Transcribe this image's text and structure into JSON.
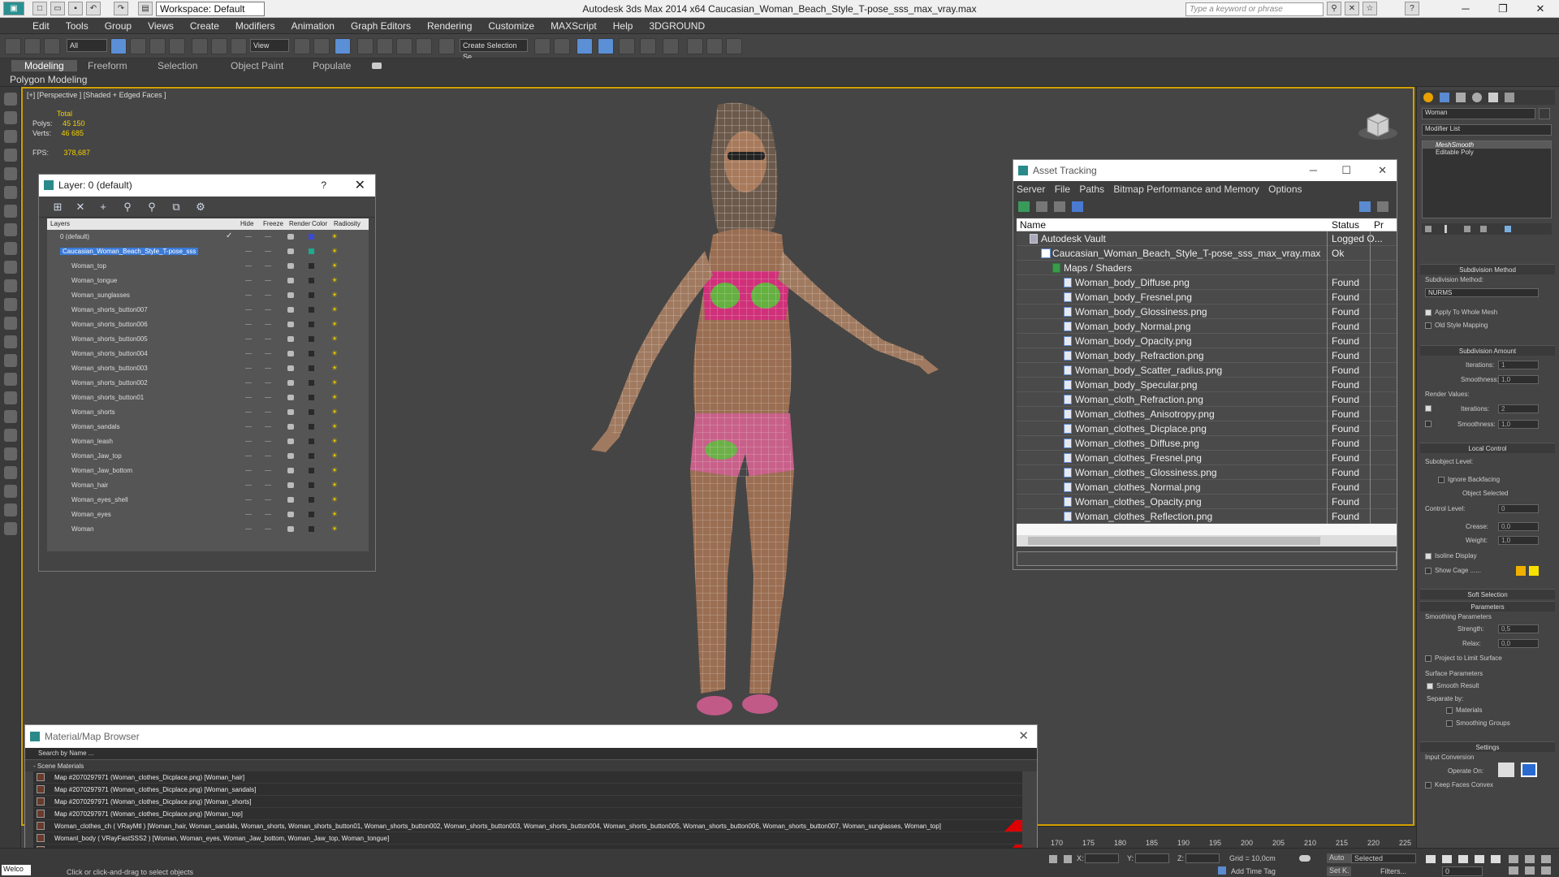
{
  "window": {
    "title": "Autodesk 3ds Max  2014 x64    Caucasian_Woman_Beach_Style_T-pose_sss_max_vray.max",
    "workspace": "Workspace: Default",
    "search_placeholder": "Type a keyword or phrase"
  },
  "menu": [
    "Edit",
    "Tools",
    "Group",
    "Views",
    "Create",
    "Modifiers",
    "Animation",
    "Graph Editors",
    "Rendering",
    "Customize",
    "MAXScript",
    "Help",
    "3DGROUND"
  ],
  "toolbar": {
    "filter": "All",
    "refcoord": "View",
    "selection_set": "Create Selection Se"
  },
  "ribbon": {
    "tabs": [
      "Modeling",
      "Freeform",
      "Selection",
      "Object Paint",
      "Populate"
    ],
    "sub": "Polygon Modeling"
  },
  "viewport": {
    "label": "[+] [Perspective ] [Shaded + Edged Faces ]",
    "stats_total": "Total",
    "polys_label": "Polys:",
    "polys": "45 150",
    "verts_label": "Verts:",
    "verts": "46 685",
    "fps_label": "FPS:",
    "fps": "378,687"
  },
  "layer_dialog": {
    "title": "Layer: 0 (default)",
    "help": "?",
    "columns": [
      "Layers",
      "Hide",
      "Freeze",
      "Render",
      "Color",
      "Radiosity"
    ],
    "rows": [
      {
        "name": "0 (default)",
        "level": 0,
        "color": "#3a4ad8",
        "check": true
      },
      {
        "name": "Caucasian_Woman_Beach_Style_T-pose_sss",
        "level": 0,
        "color": "#20a890",
        "selected": true
      },
      {
        "name": "Woman_top",
        "level": 1,
        "color": "#2a2a2a"
      },
      {
        "name": "Woman_tongue",
        "level": 1,
        "color": "#2a2a2a"
      },
      {
        "name": "Woman_sunglasses",
        "level": 1,
        "color": "#2a2a2a"
      },
      {
        "name": "Woman_shorts_button007",
        "level": 1,
        "color": "#2a2a2a"
      },
      {
        "name": "Woman_shorts_button006",
        "level": 1,
        "color": "#2a2a2a"
      },
      {
        "name": "Woman_shorts_button005",
        "level": 1,
        "color": "#2a2a2a"
      },
      {
        "name": "Woman_shorts_button004",
        "level": 1,
        "color": "#2a2a2a"
      },
      {
        "name": "Woman_shorts_button003",
        "level": 1,
        "color": "#2a2a2a"
      },
      {
        "name": "Woman_shorts_button002",
        "level": 1,
        "color": "#2a2a2a"
      },
      {
        "name": "Woman_shorts_button01",
        "level": 1,
        "color": "#2a2a2a"
      },
      {
        "name": "Woman_shorts",
        "level": 1,
        "color": "#2a2a2a"
      },
      {
        "name": "Woman_sandals",
        "level": 1,
        "color": "#2a2a2a"
      },
      {
        "name": "Woman_leash",
        "level": 1,
        "color": "#2a2a2a"
      },
      {
        "name": "Woman_Jaw_top",
        "level": 1,
        "color": "#2a2a2a"
      },
      {
        "name": "Woman_Jaw_bottom",
        "level": 1,
        "color": "#2a2a2a"
      },
      {
        "name": "Woman_hair",
        "level": 1,
        "color": "#2a2a2a"
      },
      {
        "name": "Woman_eyes_shell",
        "level": 1,
        "color": "#2a2a2a"
      },
      {
        "name": "Woman_eyes",
        "level": 1,
        "color": "#2a2a2a"
      },
      {
        "name": "Woman",
        "level": 1,
        "color": "#2a2a2a"
      }
    ]
  },
  "asset_dialog": {
    "title": "Asset Tracking",
    "menu": [
      "Server",
      "File",
      "Paths",
      "Bitmap Performance and Memory",
      "Options"
    ],
    "columns": {
      "name": "Name",
      "status": "Status",
      "proxy": "Pr"
    },
    "rows": [
      {
        "name": "Autodesk Vault",
        "status": "Logged O...",
        "indent": 0,
        "kind": "vault"
      },
      {
        "name": "Caucasian_Woman_Beach_Style_T-pose_sss_max_vray.max",
        "status": "Ok",
        "indent": 1,
        "kind": "file"
      },
      {
        "name": "Maps / Shaders",
        "status": "",
        "indent": 2,
        "kind": "folder"
      },
      {
        "name": "Woman_body_Diffuse.png",
        "status": "Found",
        "indent": 3,
        "kind": "map"
      },
      {
        "name": "Woman_body_Fresnel.png",
        "status": "Found",
        "indent": 3,
        "kind": "map"
      },
      {
        "name": "Woman_body_Glossiness.png",
        "status": "Found",
        "indent": 3,
        "kind": "map"
      },
      {
        "name": "Woman_body_Normal.png",
        "status": "Found",
        "indent": 3,
        "kind": "map"
      },
      {
        "name": "Woman_body_Opacity.png",
        "status": "Found",
        "indent": 3,
        "kind": "map"
      },
      {
        "name": "Woman_body_Refraction.png",
        "status": "Found",
        "indent": 3,
        "kind": "map"
      },
      {
        "name": "Woman_body_Scatter_radius.png",
        "status": "Found",
        "indent": 3,
        "kind": "map"
      },
      {
        "name": "Woman_body_Specular.png",
        "status": "Found",
        "indent": 3,
        "kind": "map"
      },
      {
        "name": "Woman_cloth_Refraction.png",
        "status": "Found",
        "indent": 3,
        "kind": "map"
      },
      {
        "name": "Woman_clothes_Anisotropy.png",
        "status": "Found",
        "indent": 3,
        "kind": "map"
      },
      {
        "name": "Woman_clothes_Dicplace.png",
        "status": "Found",
        "indent": 3,
        "kind": "map"
      },
      {
        "name": "Woman_clothes_Diffuse.png",
        "status": "Found",
        "indent": 3,
        "kind": "map"
      },
      {
        "name": "Woman_clothes_Fresnel.png",
        "status": "Found",
        "indent": 3,
        "kind": "map"
      },
      {
        "name": "Woman_clothes_Glossiness.png",
        "status": "Found",
        "indent": 3,
        "kind": "map"
      },
      {
        "name": "Woman_clothes_Normal.png",
        "status": "Found",
        "indent": 3,
        "kind": "map"
      },
      {
        "name": "Woman_clothes_Opacity.png",
        "status": "Found",
        "indent": 3,
        "kind": "map"
      },
      {
        "name": "Woman_clothes_Reflection.png",
        "status": "Found",
        "indent": 3,
        "kind": "map"
      }
    ]
  },
  "material_browser": {
    "title": "Material/Map Browser",
    "search": "Search by Name ...",
    "section": "- Scene Materials",
    "rows": [
      {
        "text": "Map #2070297971 (Woman_clothes_Dicplace.png) [Woman_hair]",
        "red": false
      },
      {
        "text": "Map #2070297971 (Woman_clothes_Dicplace.png) [Woman_sandals]",
        "red": false
      },
      {
        "text": "Map #2070297971 (Woman_clothes_Dicplace.png) [Woman_shorts]",
        "red": false
      },
      {
        "text": "Map #2070297971 (Woman_clothes_Dicplace.png) [Woman_top]",
        "red": false
      },
      {
        "text": "Woman_clothes_ch ( VRayMtl ) [Woman_hair, Woman_sandals, Woman_shorts, Woman_shorts_button01, Woman_shorts_button002, Woman_shorts_button003, Woman_shorts_button004, Woman_shorts_button005, Woman_shorts_button006, Woman_shorts_button007, Woman_sunglasses, Woman_top]",
        "red": true
      },
      {
        "text": "Womanl_body ( VRayFastSSS2 ) [Woman, Woman_eyes, Woman_Jaw_bottom, Woman_Jaw_top, Woman_tongue]",
        "red": false
      },
      {
        "text": "Woman_body_detail ( VRayMtl ) [Woman_eyes_shell, Woman_leash]",
        "red": true
      }
    ]
  },
  "command_panel": {
    "object_name": "Woman",
    "modifier_list": "Modifier List",
    "stack": [
      "MeshSmooth",
      "Editable Poly"
    ],
    "subdivision_method_title": "Subdivision Method",
    "subdivision_method_label": "Subdivision Method:",
    "subdivision_method": "NURMS",
    "apply_whole_mesh": "Apply To Whole Mesh",
    "old_style_mapping": "Old Style Mapping",
    "subdivision_amount": "Subdivision Amount",
    "iterations_label": "Iterations:",
    "iterations": "1",
    "smoothness_label": "Smoothness:",
    "smoothness": "1,0",
    "render_values": "Render Values:",
    "r_iterations": "2",
    "r_smoothness": "1,0",
    "local_control": "Local Control",
    "subobject_level": "Subobject Level:",
    "ignore_backfacing": "Ignore Backfacing",
    "object_selected": "Object Selected",
    "control_level": "Control Level:",
    "control_level_val": "0",
    "crease": "Crease:",
    "crease_val": "0,0",
    "weight": "Weight:",
    "weight_val": "1,0",
    "isoline_display": "Isoline Display",
    "show_cage": "Show Cage ......",
    "soft_selection": "Soft Selection",
    "parameters": "Parameters",
    "smoothing_params": "Smoothing Parameters",
    "strength": "Strength:",
    "strength_val": "0,5",
    "relax": "Relax:",
    "relax_val": "0,0",
    "project_limit": "Project to Limit Surface",
    "surface_params": "Surface Parameters",
    "smooth_result": "Smooth Result",
    "separate_by": "Separate by:",
    "materials": "Materials",
    "smoothing_groups": "Smoothing Groups",
    "settings": "Settings",
    "input_conversion": "Input Conversion",
    "operate_on": "Operate On:",
    "keep_faces_convex": "Keep Faces Convex"
  },
  "timeline": {
    "ticks": [
      "170",
      "175",
      "180",
      "185",
      "190",
      "195",
      "200",
      "205",
      "210",
      "215",
      "220",
      "225"
    ]
  },
  "status": {
    "welcome": "Welco",
    "prompt": "Click or click-and-drag to select objects",
    "x": "X:",
    "y": "Y:",
    "z": "Z:",
    "grid": "Grid = 10,0cm",
    "add_time_tag": "Add Time Tag",
    "auto": "Auto",
    "selected": "Selected",
    "setk": "Set K.",
    "filters": "Filters...",
    "frame": "0"
  }
}
